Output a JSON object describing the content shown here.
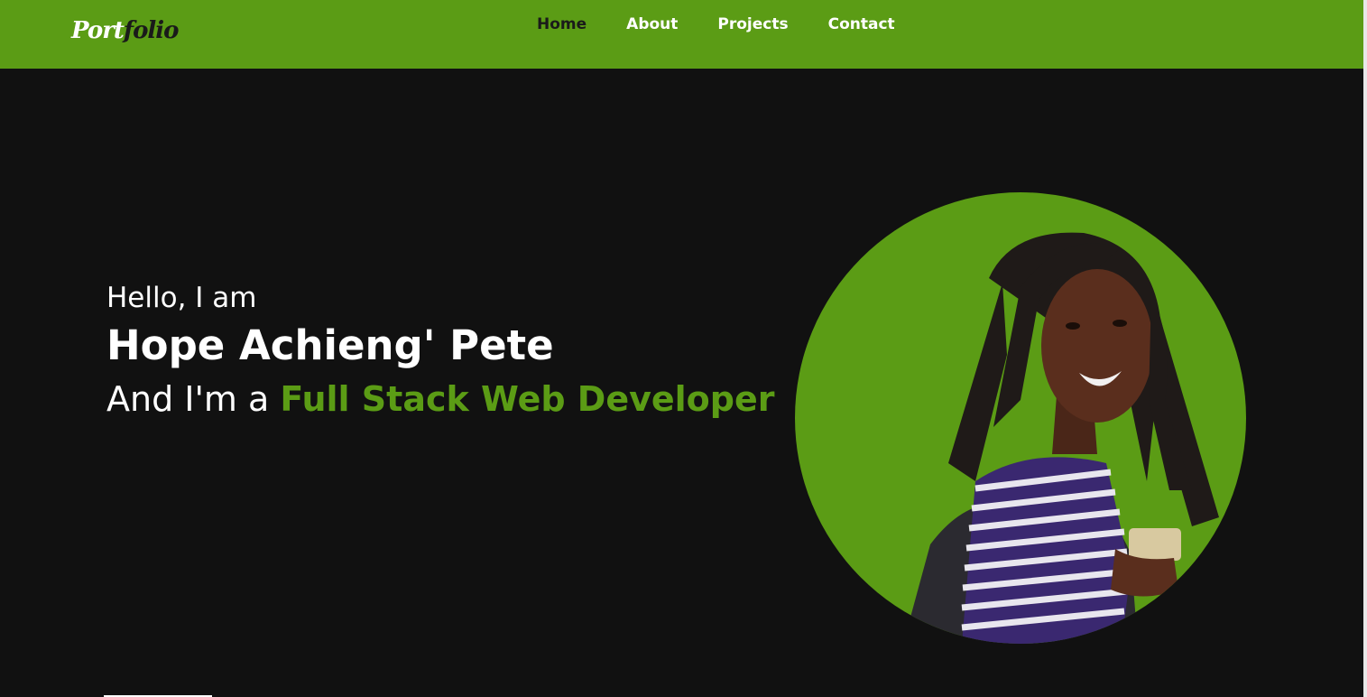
{
  "header": {
    "logo_part1": "Port",
    "logo_part2": "folio",
    "nav": [
      {
        "label": "Home",
        "active": true
      },
      {
        "label": "About",
        "active": false
      },
      {
        "label": "Projects",
        "active": false
      },
      {
        "label": "Contact",
        "active": false
      }
    ]
  },
  "hero": {
    "greeting": "Hello, I am",
    "name": "Hope Achieng' Pete",
    "role_prefix": "And I'm a ",
    "role_highlight": "Full Stack Web Developer"
  },
  "colors": {
    "accent": "#5b9c15",
    "background": "#111111",
    "text": "#ffffff",
    "nav_active": "#1a1a1a"
  }
}
